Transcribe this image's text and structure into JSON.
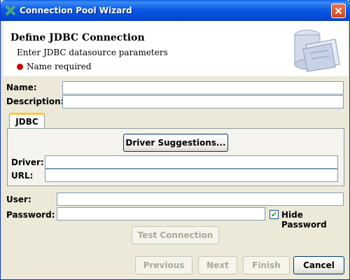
{
  "window": {
    "title": "Connection Pool Wizard"
  },
  "banner": {
    "title": "Define JDBC Connection",
    "subtitle": "Enter JDBC datasource parameters",
    "status": "Name required",
    "status_color": "#d40000"
  },
  "form": {
    "name_label": "Name:",
    "name_value": "",
    "description_label": "Description:",
    "description_value": "",
    "user_label": "User:",
    "user_value": "",
    "password_label": "Password:",
    "password_value": "",
    "hide_password_label": "Hide Password",
    "hide_password_checked": true
  },
  "jdbc_tab": {
    "tab_label": "JDBC",
    "driver_suggestions_label": "Driver Suggestions...",
    "driver_label": "Driver:",
    "driver_value": "",
    "url_label": "URL:",
    "url_value": ""
  },
  "buttons": {
    "test_connection": "Test Connection",
    "previous": "Previous",
    "next": "Next",
    "finish": "Finish",
    "cancel": "Cancel"
  },
  "colors": {
    "titlebar": "#0a5fe6",
    "accent": "#ffc83c"
  }
}
